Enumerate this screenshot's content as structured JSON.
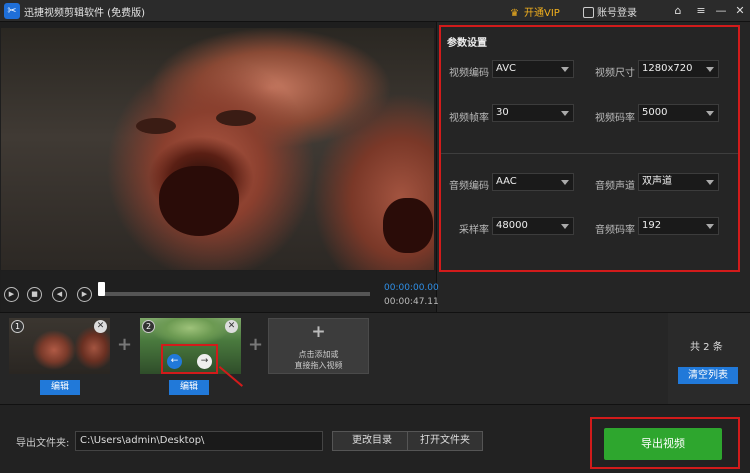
{
  "titlebar": {
    "app_title": "迅捷视频剪辑软件 (免费版)",
    "vip_label": "开通VIP",
    "login_label": "账号登录"
  },
  "params": {
    "title": "参数设置",
    "video": [
      {
        "label": "视频编码",
        "value": "AVC"
      },
      {
        "label": "视频尺寸",
        "value": "1280x720"
      },
      {
        "label": "视频帧率",
        "value": "30"
      },
      {
        "label": "视频码率",
        "value": "5000"
      }
    ],
    "audio": [
      {
        "label": "音频编码",
        "value": "AAC"
      },
      {
        "label": "音频声道",
        "value": "双声道"
      },
      {
        "label": "采样率",
        "value": "48000"
      },
      {
        "label": "音频码率",
        "value": "192"
      }
    ]
  },
  "playback": {
    "current_time": "00:00:00.00",
    "total_time": "00:00:47.11",
    "progress": 0
  },
  "clips": {
    "items": [
      {
        "number": "1",
        "edit_label": "编辑"
      },
      {
        "number": "2",
        "edit_label": "编辑"
      }
    ],
    "add_line1": "点击添加或",
    "add_line2": "直接拖入视频",
    "count_label": "共 2 条",
    "clear_label": "清空列表"
  },
  "export": {
    "folder_label": "导出文件夹:",
    "path": "C:\\Users\\admin\\Desktop\\",
    "change_dir_label": "更改目录",
    "open_folder_label": "打开文件夹",
    "export_label": "导出视频"
  },
  "colors": {
    "accent_blue": "#2179d9",
    "export_green": "#2ea62e",
    "highlight_red": "#d21b1b",
    "vip_gold": "#f2b01e"
  }
}
